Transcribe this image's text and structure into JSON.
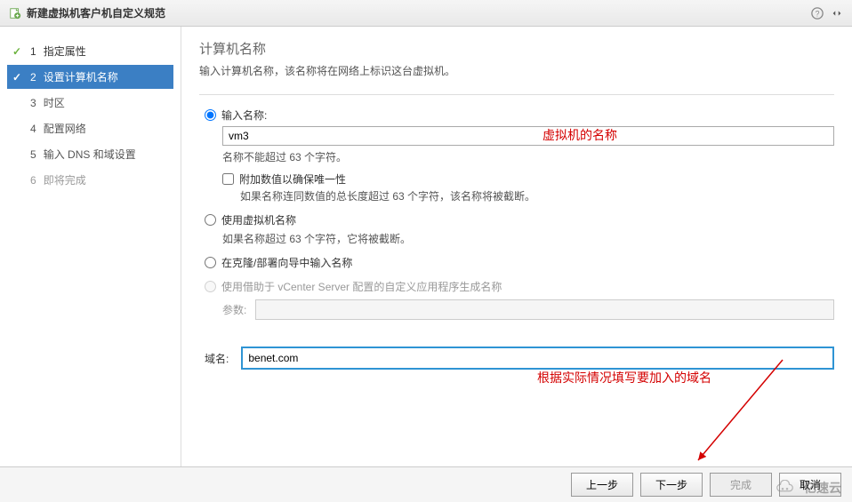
{
  "title": "新建虚拟机客户机自定义规范",
  "steps": [
    {
      "num": "1",
      "label": "指定属性",
      "state": "completed"
    },
    {
      "num": "2",
      "label": "设置计算机名称",
      "state": "active"
    },
    {
      "num": "3",
      "label": "时区",
      "state": "pending"
    },
    {
      "num": "4",
      "label": "配置网络",
      "state": "pending"
    },
    {
      "num": "5",
      "label": "输入 DNS 和域设置",
      "state": "pending"
    },
    {
      "num": "6",
      "label": "即将完成",
      "state": "disabled"
    }
  ],
  "main": {
    "heading": "计算机名称",
    "subheading": "输入计算机名称，该名称将在网络上标识这台虚拟机。",
    "opt1": {
      "label": "输入名称:",
      "value": "vm3",
      "hint": "名称不能超过 63 个字符。",
      "checkbox_label": "附加数值以确保唯一性",
      "checkbox_hint": "如果名称连同数值的总长度超过 63 个字符，该名称将被截断。"
    },
    "opt2": {
      "label": "使用虚拟机名称",
      "hint": "如果名称超过 63 个字符，它将被截断。"
    },
    "opt3": {
      "label": "在克隆/部署向导中输入名称"
    },
    "opt4": {
      "label": "使用借助于 vCenter Server 配置的自定义应用程序生成名称",
      "param_label": "参数:"
    },
    "domain": {
      "label": "域名:",
      "value": "benet.com"
    }
  },
  "annotations": {
    "vm_name": "虚拟机的名称",
    "domain_hint": "根据实际情况填写要加入的域名"
  },
  "footer": {
    "prev": "上一步",
    "next": "下一步",
    "finish": "完成",
    "cancel": "取消"
  },
  "watermark": "亿速云"
}
